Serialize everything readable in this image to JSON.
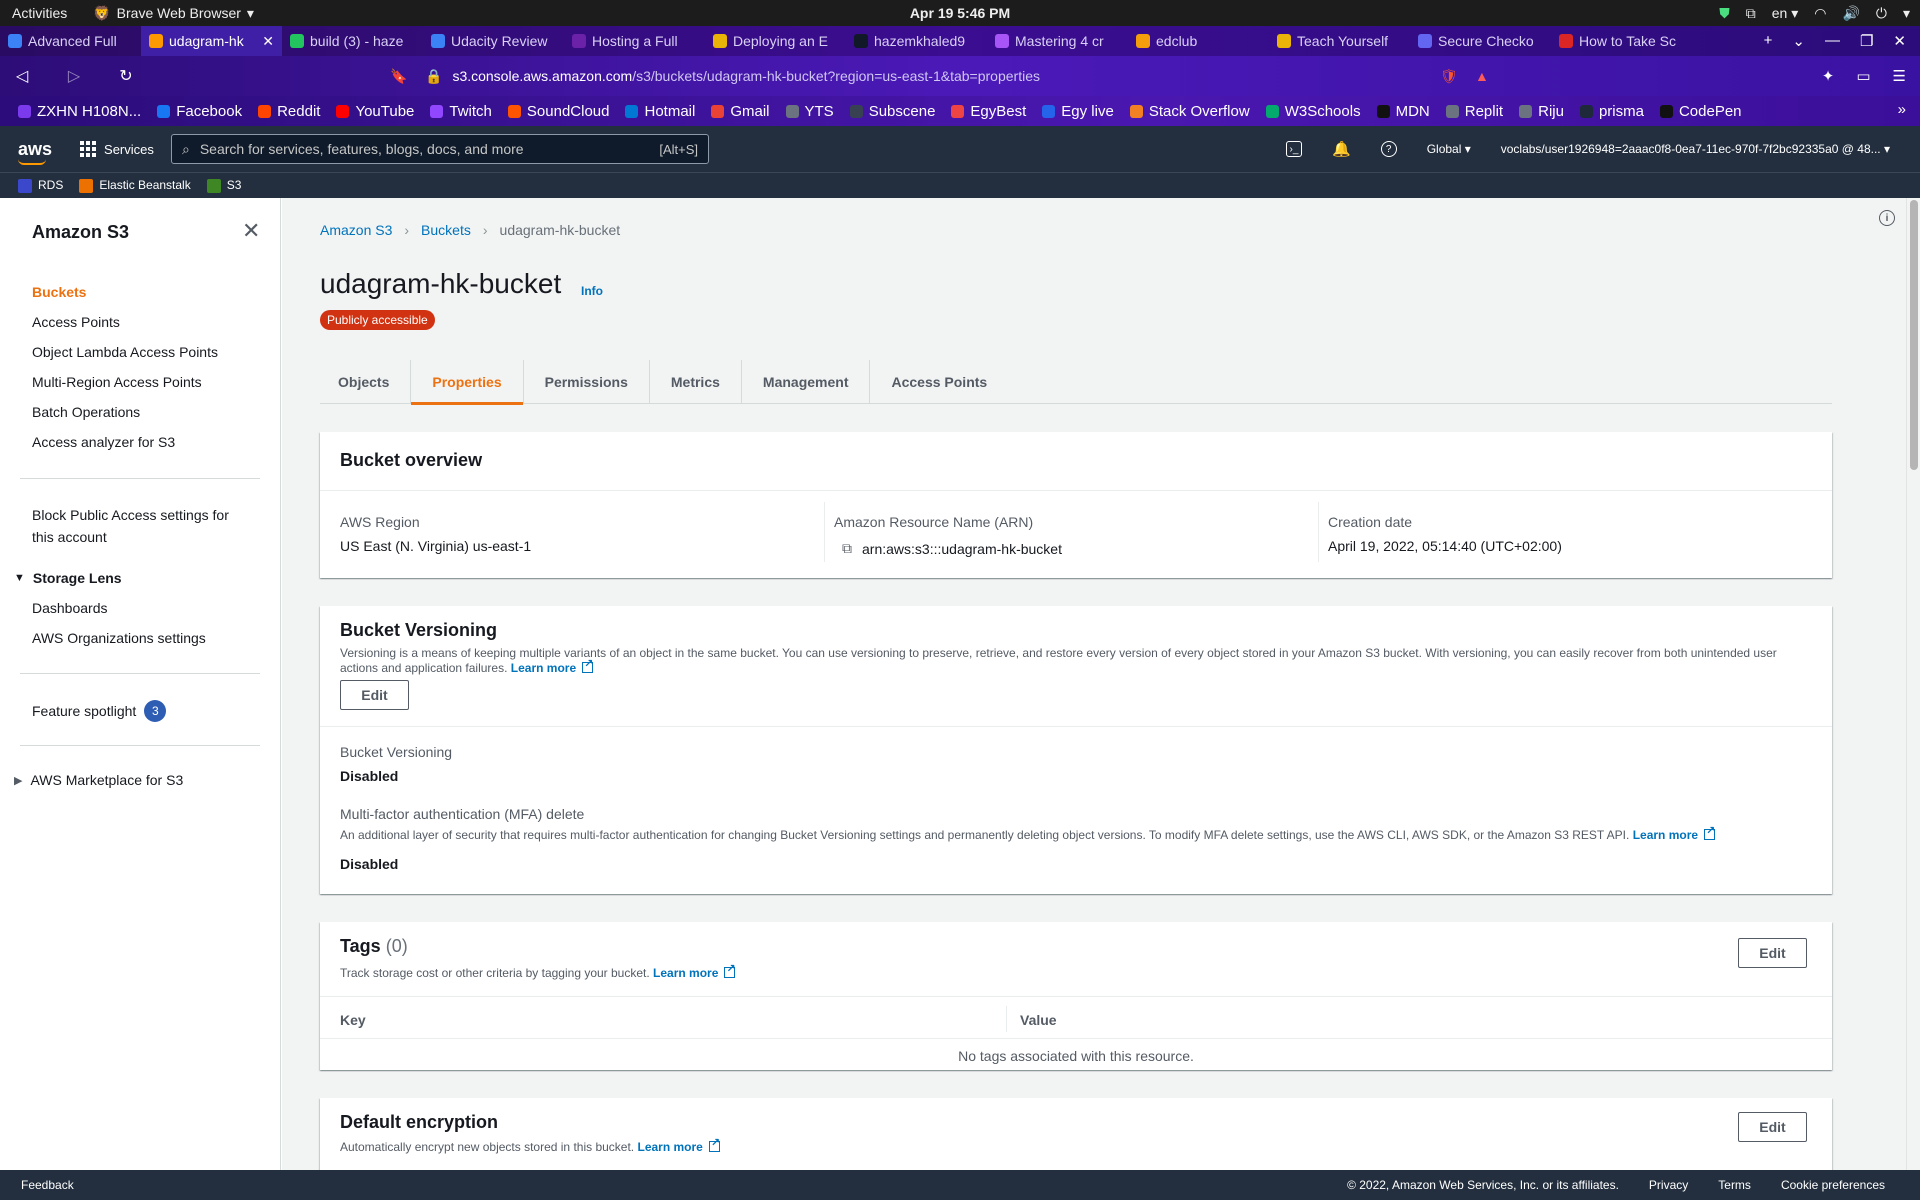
{
  "os": {
    "activities": "Activities",
    "app_name": "Brave Web Browser",
    "clock": "Apr 19  5:46 PM",
    "lang": "en"
  },
  "browser": {
    "tabs": [
      {
        "title": "Advanced Full",
        "color": "#3b82f6",
        "active": false
      },
      {
        "title": "udagram-hk",
        "color": "#ff9900",
        "active": true
      },
      {
        "title": "build (3) - haze",
        "color": "#22c55e",
        "active": false
      },
      {
        "title": "Udacity Review",
        "color": "#3b82f6",
        "active": false
      },
      {
        "title": "Hosting a Full",
        "color": "#6b21a8",
        "active": false
      },
      {
        "title": "Deploying an E",
        "color": "#eab308",
        "active": false
      },
      {
        "title": "hazemkhaled9",
        "color": "#111827",
        "active": false
      },
      {
        "title": "Mastering 4 cr",
        "color": "#a855f7",
        "active": false
      },
      {
        "title": "edclub",
        "color": "#f59e0b",
        "active": false
      },
      {
        "title": "Teach Yourself",
        "color": "#eab308",
        "active": false
      },
      {
        "title": "Secure Checko",
        "color": "#6366f1",
        "active": false
      },
      {
        "title": "How to Take Sc",
        "color": "#dc2626",
        "active": false
      }
    ],
    "url_host": "s3.console.aws.amazon.com",
    "url_path": "/s3/buckets/udagram-hk-bucket?region=us-east-1&tab=properties",
    "bookmarks": [
      {
        "label": "ZXHN H108N...",
        "color": "#7c3aed"
      },
      {
        "label": "Facebook",
        "color": "#1877f2"
      },
      {
        "label": "Reddit",
        "color": "#ff4500"
      },
      {
        "label": "YouTube",
        "color": "#ff0000"
      },
      {
        "label": "Twitch",
        "color": "#9146ff"
      },
      {
        "label": "SoundCloud",
        "color": "#ff5500"
      },
      {
        "label": "Hotmail",
        "color": "#0078d4"
      },
      {
        "label": "Gmail",
        "color": "#ea4335"
      },
      {
        "label": "YTS",
        "color": "#6b7280"
      },
      {
        "label": "Subscene",
        "color": "#374151"
      },
      {
        "label": "EgyBest",
        "color": "#ef4444"
      },
      {
        "label": "Egy live",
        "color": "#2563eb"
      },
      {
        "label": "Stack Overflow",
        "color": "#f48024"
      },
      {
        "label": "W3Schools",
        "color": "#04aa6d"
      },
      {
        "label": "MDN",
        "color": "#111111"
      },
      {
        "label": "Replit",
        "color": "#6b7280"
      },
      {
        "label": "Riju",
        "color": "#6b7280"
      },
      {
        "label": "prisma",
        "color": "#1e293b"
      },
      {
        "label": "CodePen",
        "color": "#111111"
      }
    ]
  },
  "aws_header": {
    "logo": "aws",
    "services": "Services",
    "search_placeholder": "Search for services, features, blogs, docs, and more",
    "search_shortcut": "[Alt+S]",
    "region": "Global",
    "account": "voclabs/user1926948=2aaac0f8-0ea7-11ec-970f-7f2bc92335a0 @ 48...",
    "favorites": [
      {
        "label": "RDS",
        "color": "#3b48cc"
      },
      {
        "label": "Elastic Beanstalk",
        "color": "#ed7100"
      },
      {
        "label": "S3",
        "color": "#3f8624"
      }
    ]
  },
  "sidebar": {
    "title": "Amazon S3",
    "items": [
      {
        "label": "Buckets",
        "active": true
      },
      {
        "label": "Access Points"
      },
      {
        "label": "Object Lambda Access Points"
      },
      {
        "label": "Multi-Region Access Points"
      },
      {
        "label": "Batch Operations"
      },
      {
        "label": "Access analyzer for S3"
      }
    ],
    "block_public": "Block Public Access settings for this account",
    "storage_lens": "Storage Lens",
    "storage_lens_items": [
      "Dashboards",
      "AWS Organizations settings"
    ],
    "feature_spotlight": "Feature spotlight",
    "feature_count": "3",
    "marketplace": "AWS Marketplace for S3"
  },
  "main": {
    "breadcrumb": [
      "Amazon S3",
      "Buckets",
      "udagram-hk-bucket"
    ],
    "title": "udagram-hk-bucket",
    "info": "Info",
    "badge": "Publicly accessible",
    "tabs": [
      "Objects",
      "Properties",
      "Permissions",
      "Metrics",
      "Management",
      "Access Points"
    ],
    "active_tab": "Properties",
    "overview": {
      "heading": "Bucket overview",
      "region_label": "AWS Region",
      "region_value": "US East (N. Virginia) us-east-1",
      "arn_label": "Amazon Resource Name (ARN)",
      "arn_value": "arn:aws:s3:::udagram-hk-bucket",
      "date_label": "Creation date",
      "date_value": "April 19, 2022, 05:14:40 (UTC+02:00)"
    },
    "versioning": {
      "heading": "Bucket Versioning",
      "desc": "Versioning is a means of keeping multiple variants of an object in the same bucket. You can use versioning to preserve, retrieve, and restore every version of every object stored in your Amazon S3 bucket. With versioning, you can easily recover from both unintended user actions and application failures.",
      "learn_more": "Learn more",
      "edit": "Edit",
      "versioning_label": "Bucket Versioning",
      "versioning_value": "Disabled",
      "mfa_label": "Multi-factor authentication (MFA) delete",
      "mfa_desc": "An additional layer of security that requires multi-factor authentication for changing Bucket Versioning settings and permanently deleting object versions. To modify MFA delete settings, use the AWS CLI, AWS SDK, or the Amazon S3 REST API.",
      "mfa_value": "Disabled"
    },
    "tags": {
      "heading": "Tags",
      "count": "(0)",
      "desc": "Track storage cost or other criteria by tagging your bucket.",
      "learn_more": "Learn more",
      "edit": "Edit",
      "col_key": "Key",
      "col_value": "Value",
      "empty": "No tags associated with this resource."
    },
    "encryption": {
      "heading": "Default encryption",
      "desc": "Automatically encrypt new objects stored in this bucket.",
      "learn_more": "Learn more",
      "edit": "Edit"
    }
  },
  "footer": {
    "feedback": "Feedback",
    "copyright": "© 2022, Amazon Web Services, Inc. or its affiliates.",
    "links": [
      "Privacy",
      "Terms",
      "Cookie preferences"
    ]
  }
}
